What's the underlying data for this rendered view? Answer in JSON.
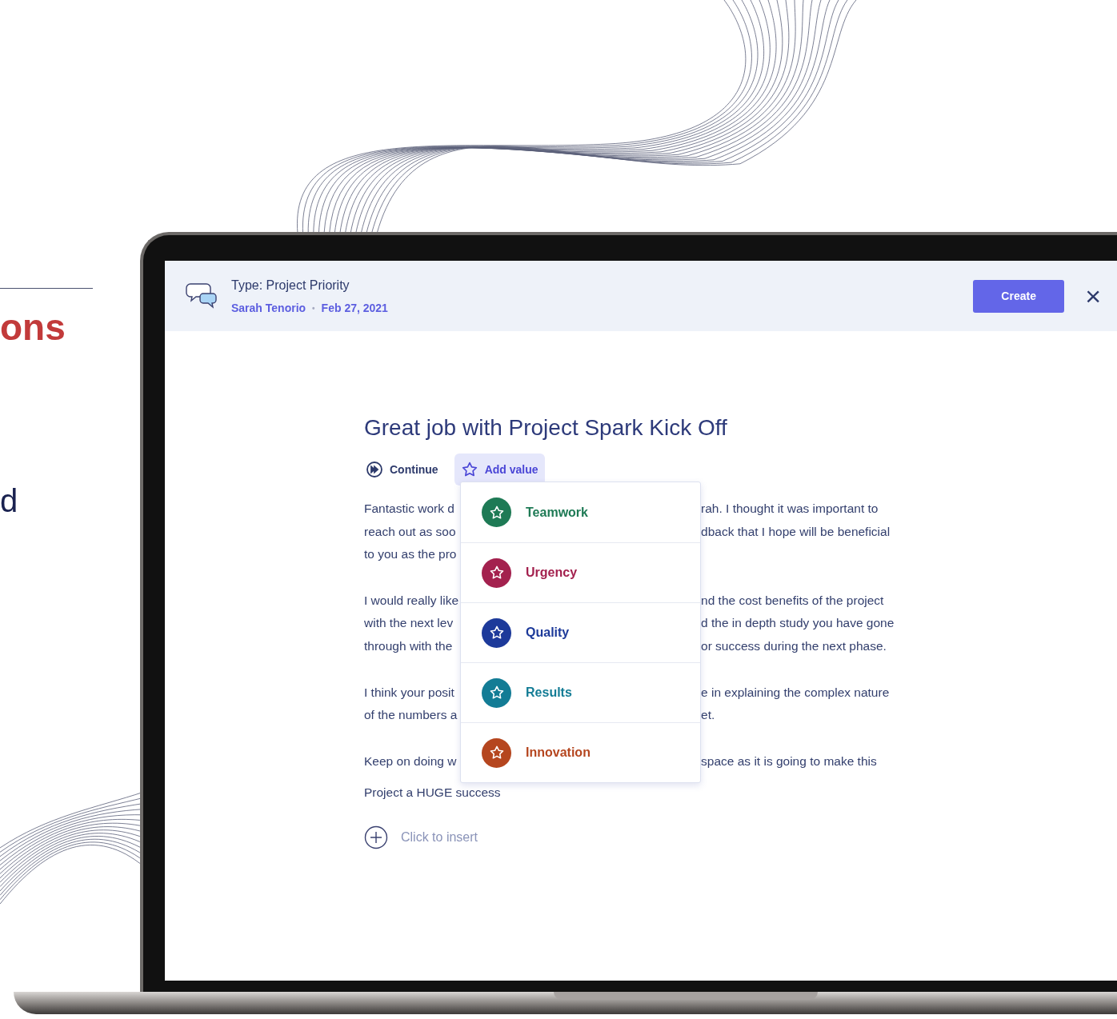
{
  "backdrop": {
    "heading_fragment": "ons",
    "text_fragment": "d"
  },
  "header": {
    "title": "Type: Project Priority",
    "author": "Sarah Tenorio",
    "separator": "•",
    "date": "Feb 27, 2021",
    "create_button": "Create",
    "close": "×"
  },
  "note": {
    "title": "Great job with Project Spark Kick Off",
    "actions": [
      {
        "kind": "continue",
        "label": "Continue",
        "active": false
      },
      {
        "kind": "value",
        "label": "Add value",
        "active": true
      }
    ],
    "paragraphs": [
      {
        "lines": [
          {
            "left": "Fantastic work d",
            "right": "rah. I thought it was important to"
          },
          {
            "left": "reach out as soo",
            "right": "dback that I hope will be beneficial"
          },
          {
            "left": "to you as the pro"
          }
        ]
      },
      {
        "lines": [
          {
            "left": "I would really like",
            "right": "nd the cost benefits of the project"
          },
          {
            "left": "with the next lev",
            "right": "d the in depth study you have gone"
          },
          {
            "left": "through with the",
            "right": "or success during the next phase."
          }
        ]
      },
      {
        "lines": [
          {
            "left": "I think your posit",
            "right": "e in explaining the complex nature"
          },
          {
            "left": "of the numbers a",
            "right": "et."
          }
        ]
      },
      {
        "lines": [
          {
            "left": "Keep on doing w",
            "right": "space as it is going to make this"
          }
        ]
      }
    ],
    "last_line": "Project a HUGE success",
    "insert_hint": "Click to insert"
  },
  "value_menu": {
    "items": [
      {
        "label": "Teamwork",
        "color": "#1e7a55"
      },
      {
        "label": "Urgency",
        "color": "#a3214e"
      },
      {
        "label": "Quality",
        "color": "#1d3a9a"
      },
      {
        "label": "Results",
        "color": "#137c95"
      },
      {
        "label": "Innovation",
        "color": "#b5461f"
      }
    ]
  }
}
